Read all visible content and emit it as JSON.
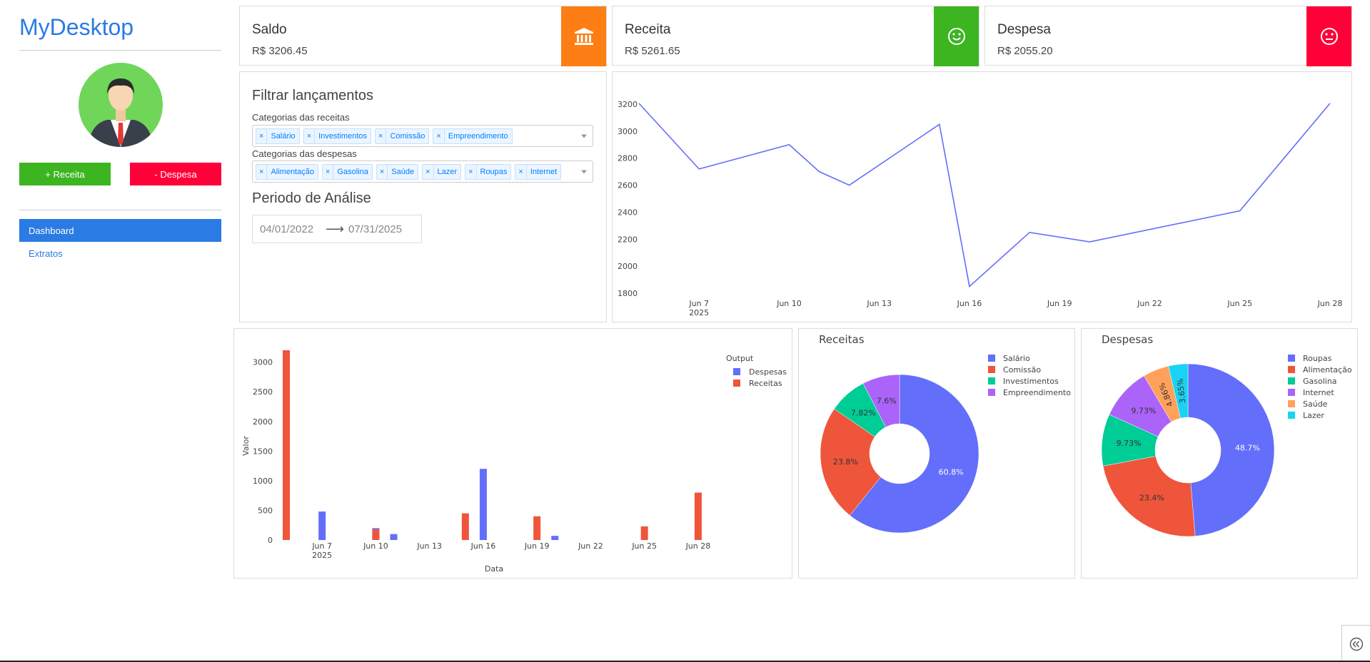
{
  "sidebar": {
    "brand": "MyDesktop",
    "btn_receita": "+ Receita",
    "btn_despesa": "- Despesa",
    "nav": [
      {
        "label": "Dashboard",
        "active": true
      },
      {
        "label": "Extratos",
        "active": false
      }
    ]
  },
  "stats": {
    "saldo": {
      "title": "Saldo",
      "value": "R$ 3206.45",
      "color": "#fd7e14",
      "icon": "bank-icon"
    },
    "receita": {
      "title": "Receita",
      "value": "R$ 5261.65",
      "color": "#3cb521",
      "icon": "smile-icon"
    },
    "despesa": {
      "title": "Despesa",
      "value": "R$ 2055.20",
      "color": "#ff0039",
      "icon": "neutral-face-icon"
    }
  },
  "filter": {
    "title": "Filtrar lançamentos",
    "receitas_label": "Categorias das receitas",
    "receitas_tags": [
      "Salário",
      "Investimentos",
      "Comissão",
      "Empreendimento"
    ],
    "despesas_label": "Categorias das despesas",
    "despesas_tags": [
      "Alimentação",
      "Gasolina",
      "Saúde",
      "Lazer",
      "Roupas",
      "Internet"
    ],
    "periodo_title": "Periodo de Análise",
    "start_date": "04/01/2022",
    "end_date": "07/31/2025"
  },
  "chart_data": [
    {
      "type": "line",
      "x_ticks": [
        "Jun 7",
        "Jun 10",
        "Jun 13",
        "Jun 16",
        "Jun 19",
        "Jun 22",
        "Jun 25",
        "Jun 28"
      ],
      "x_tick_year": "2025",
      "y_ticks": [
        1800,
        2000,
        2200,
        2400,
        2600,
        2800,
        3000,
        3200
      ],
      "ylim": [
        1800,
        3200
      ],
      "color": "#636efa",
      "points": [
        {
          "x": "2025-06-05",
          "y": 3206
        },
        {
          "x": "2025-06-07",
          "y": 2720
        },
        {
          "x": "2025-06-10",
          "y": 2900
        },
        {
          "x": "2025-06-11",
          "y": 2700
        },
        {
          "x": "2025-06-12",
          "y": 2600
        },
        {
          "x": "2025-06-15",
          "y": 3050
        },
        {
          "x": "2025-06-16",
          "y": 1850
        },
        {
          "x": "2025-06-18",
          "y": 2250
        },
        {
          "x": "2025-06-20",
          "y": 2180
        },
        {
          "x": "2025-06-25",
          "y": 2410
        },
        {
          "x": "2025-06-28",
          "y": 3206
        }
      ]
    },
    {
      "type": "bar",
      "xlabel": "Data",
      "ylabel": "Valor",
      "legend_title": "Output",
      "x_ticks": [
        "Jun 7",
        "Jun 10",
        "Jun 13",
        "Jun 16",
        "Jun 19",
        "Jun 22",
        "Jun 25",
        "Jun 28"
      ],
      "x_tick_year": "2025",
      "y_ticks": [
        0,
        500,
        1000,
        1500,
        2000,
        2500,
        3000
      ],
      "ylim": [
        0,
        3200
      ],
      "series": [
        {
          "name": "Despesas",
          "color": "#636efa",
          "points": [
            {
              "x": "2025-06-07",
              "y": 480
            },
            {
              "x": "2025-06-10",
              "y": 200
            },
            {
              "x": "2025-06-11",
              "y": 100
            },
            {
              "x": "2025-06-16",
              "y": 1200
            },
            {
              "x": "2025-06-20",
              "y": 70
            }
          ]
        },
        {
          "name": "Receitas",
          "color": "#ef553b",
          "points": [
            {
              "x": "2025-06-05",
              "y": 3200
            },
            {
              "x": "2025-06-10",
              "y": 180
            },
            {
              "x": "2025-06-15",
              "y": 450
            },
            {
              "x": "2025-06-19",
              "y": 400
            },
            {
              "x": "2025-06-25",
              "y": 230
            },
            {
              "x": "2025-06-28",
              "y": 800
            }
          ]
        }
      ]
    },
    {
      "type": "pie",
      "title": "Receitas",
      "slices": [
        {
          "label": "Salário",
          "value": 60.8,
          "text": "60.8%",
          "color": "#636efa"
        },
        {
          "label": "Comissão",
          "value": 23.8,
          "text": "23.8%",
          "color": "#ef553b"
        },
        {
          "label": "Investimentos",
          "value": 7.82,
          "text": "7.82%",
          "color": "#00cc96"
        },
        {
          "label": "Empreendimento",
          "value": 7.6,
          "text": "7.6%",
          "color": "#ab63fa"
        }
      ]
    },
    {
      "type": "pie",
      "title": "Despesas",
      "slices": [
        {
          "label": "Roupas",
          "value": 48.7,
          "text": "48.7%",
          "color": "#636efa"
        },
        {
          "label": "Alimentação",
          "value": 23.4,
          "text": "23.4%",
          "color": "#ef553b"
        },
        {
          "label": "Gasolina",
          "value": 9.73,
          "text": "9.73%",
          "color": "#00cc96"
        },
        {
          "label": "Internet",
          "value": 9.73,
          "text": "9.73%",
          "color": "#ab63fa"
        },
        {
          "label": "Saúde",
          "value": 4.86,
          "text": "4.86%",
          "color": "#ffa15a"
        },
        {
          "label": "Lazer",
          "value": 3.65,
          "text": "3.65%",
          "color": "#19d3f3"
        }
      ]
    }
  ]
}
